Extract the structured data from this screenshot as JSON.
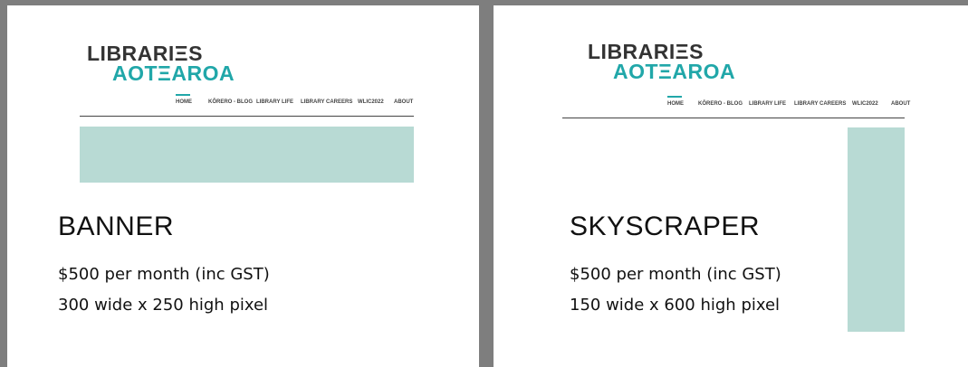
{
  "logo": {
    "line1": "LIBRARIΞS",
    "line2": "AOTΞAROA"
  },
  "nav": {
    "items": [
      "HOME",
      "KŌRERO - BLOG",
      "LIBRARY LIFE",
      "LIBRARY CAREERS",
      "WLIC2022",
      "ABOUT"
    ],
    "active": "HOME"
  },
  "colors": {
    "accent": "#21a7a9",
    "ad_placeholder": "#b8dad4",
    "frame": "#7e7e7e"
  },
  "panels": [
    {
      "title": "BANNER",
      "price": "$500 per month (inc GST)",
      "size": "300 wide x 250 high pixel"
    },
    {
      "title": "SKYSCRAPER",
      "price": "$500 per month (inc GST)",
      "size": "150 wide x 600 high pixel"
    }
  ]
}
